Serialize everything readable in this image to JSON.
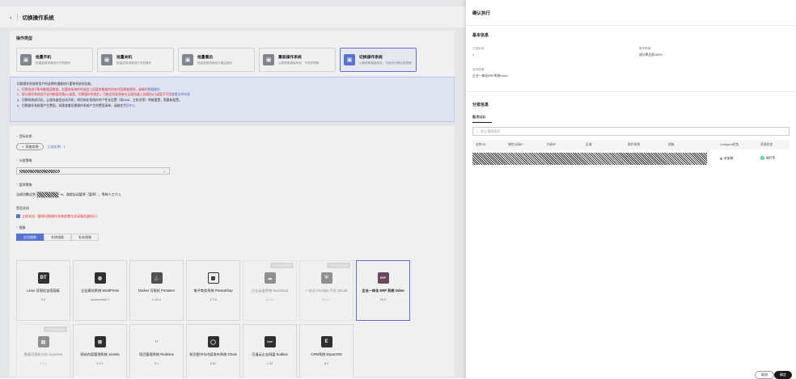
{
  "header": {
    "title": "切换操作系统"
  },
  "op_section": {
    "title": "操作类型"
  },
  "op_cards": [
    {
      "icon": "▣",
      "title": "批量开机",
      "desc": "批量选择资源进行开机操作"
    },
    {
      "icon": "▣",
      "title": "批量关机",
      "desc": "批量选择资源进行关机操作"
    },
    {
      "icon": "▣",
      "title": "批量重启",
      "desc": "批量选择资源进行重启操作"
    },
    {
      "icon": "▣",
      "title": "重装操作系统",
      "desc": "以原镜像重装系统，不改变镜像"
    },
    {
      "icon": "▣",
      "title": "切换操作系统",
      "desc": "以新镜像重装系统，可适合切换应用镜像"
    }
  ],
  "notice": {
    "intro": "切换操作系统将用户所选择的镜像进行重装系统的功能。",
    "l1": "1、切换系统不影响数据盘数据。但重装系统的时候会三层盘符数据的所有内容都被擦除，请做好",
    "l1_link": "数据备份",
    "l2": "2、部分操作系统若不支持数据切换(C)或盘，切换操作系统后，可能会导致原来在云服务器上挂载的(C)或盘不可用",
    "l2_link": "查看支持列表",
    "l3": "3、切换系统成功后，云服务器会自动开机；除初始化系统外的个性化设置（如DNS、主机名等）将被重置，需重新配置。",
    "l4": "4、切换操作系统需产生费用，如需查看切换操作系统产生的费用清单，请前往",
    "l4_link": "费用中心"
  },
  "target": {
    "label": "目标实例",
    "add_button": "添加实例",
    "selected": "已选实例：1"
  },
  "strategy": {
    "label": "分批策略"
  },
  "release": {
    "label": "暂停策略",
    "prefix": "当成功数达到",
    "suffix": "%，流程自动暂停（暂停），等待人工介入"
  },
  "shutdown": {
    "label": "是否关机",
    "option": "立即关机（重装切换操作系统前需先关闭服务器执行）"
  },
  "image": {
    "label": "镜像",
    "tabs": [
      "应用镜像",
      "系统镜像",
      "私有镜像"
    ],
    "cards": [
      {
        "logo": "BT",
        "name": "Linux 可视化宝塔面板",
        "version": "9.0",
        "badge": ""
      },
      {
        "logo": "◍",
        "name": "企业建站系统 WordPress",
        "version": "community6.2",
        "badge": ""
      },
      {
        "logo": "⚓",
        "name": "Docker 可视化 Portainer",
        "version": "2.18.4",
        "badge": ""
      },
      {
        "logo": "▦",
        "name": "电子商务系统 PrestaShop",
        "version": "1.7.8",
        "badge": ""
      },
      {
        "logo": "☁",
        "name": "企业云盘系统 Nextcloud",
        "version": "28.0.1",
        "badge": "不支持当前镜像"
      },
      {
        "logo": "Ψ",
        "name": "一站式 DevOps 平台 GitLab",
        "version": "16.0.7",
        "badge": "不支持当前镜像"
      },
      {
        "logo": "ERP",
        "name": "企业一体化 ERP 系统 Odoo",
        "version": "16.0",
        "badge": ""
      },
      {
        "logo": "▤",
        "name": "数据可视化分析 Superset",
        "version": "2.0.1",
        "badge": "不支持当前镜像"
      },
      {
        "logo": "⊠",
        "name": "网站内容管理系统 Joomla",
        "version": "4.3.1",
        "badge": ""
      },
      {
        "logo": "∩",
        "name": "项目管理系统 Redmine",
        "version": "5.1",
        "badge": ""
      },
      {
        "logo": "◯",
        "name": "知识图书与内容发布系统 Ghost",
        "version": "5.57",
        "badge": ""
      },
      {
        "logo": "kod",
        "name": "可道云企业网盘 Kodbox",
        "version": "1.42",
        "badge": ""
      },
      {
        "logo": "E",
        "name": "CRM系统 EspoCRM",
        "version": "8.0",
        "badge": ""
      }
    ]
  },
  "drawer": {
    "title": "确认执行",
    "basic_title": "基本信息",
    "instances_label": "已选实例",
    "instances_value": "1",
    "strategy_label": "暂停策略",
    "strategy_value": "成功率达到100%",
    "image_label": "目标镜像",
    "image_value": "企业一体化ERP系统Odoo",
    "batch_title": "分批信息",
    "batch_tab": "批次1(1)",
    "search_placeholder": "默认模糊搜索",
    "columns": [
      "名称/ID",
      "弹性公网IP",
      "内网IP",
      "区域",
      "操作系统",
      "规格",
      "UniAgent状态",
      "资源状态"
    ],
    "row_agent": "未安装",
    "row_status": "运行中",
    "cancel": "取消",
    "confirm": "确定"
  }
}
